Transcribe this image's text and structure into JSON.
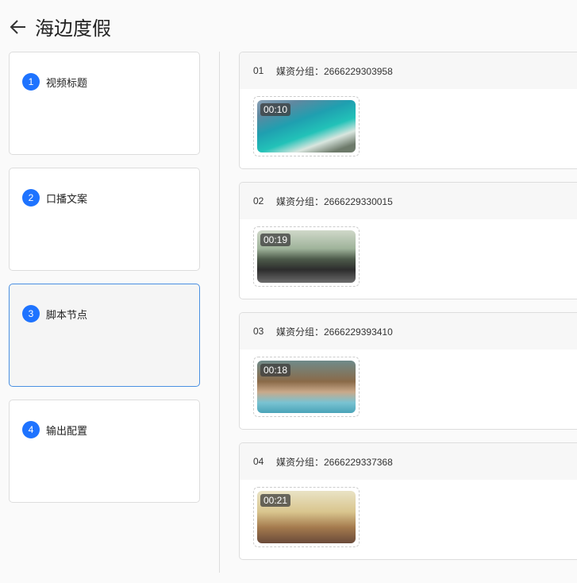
{
  "header": {
    "title": "海边度假"
  },
  "steps": [
    {
      "num": "1",
      "label": "视频标题"
    },
    {
      "num": "2",
      "label": "口播文案"
    },
    {
      "num": "3",
      "label": "脚本节点"
    },
    {
      "num": "4",
      "label": "输出配置"
    }
  ],
  "nodes": [
    {
      "index": "01",
      "group": "媒资分组：2666229303958",
      "duration": "00:10"
    },
    {
      "index": "02",
      "group": "媒资分组：2666229330015",
      "duration": "00:19"
    },
    {
      "index": "03",
      "group": "媒资分组：2666229393410",
      "duration": "00:18"
    },
    {
      "index": "04",
      "group": "媒资分组：2666229337368",
      "duration": "00:21"
    }
  ],
  "colors": {
    "accent": "#1e73ff",
    "active_border": "#4a90e2"
  }
}
